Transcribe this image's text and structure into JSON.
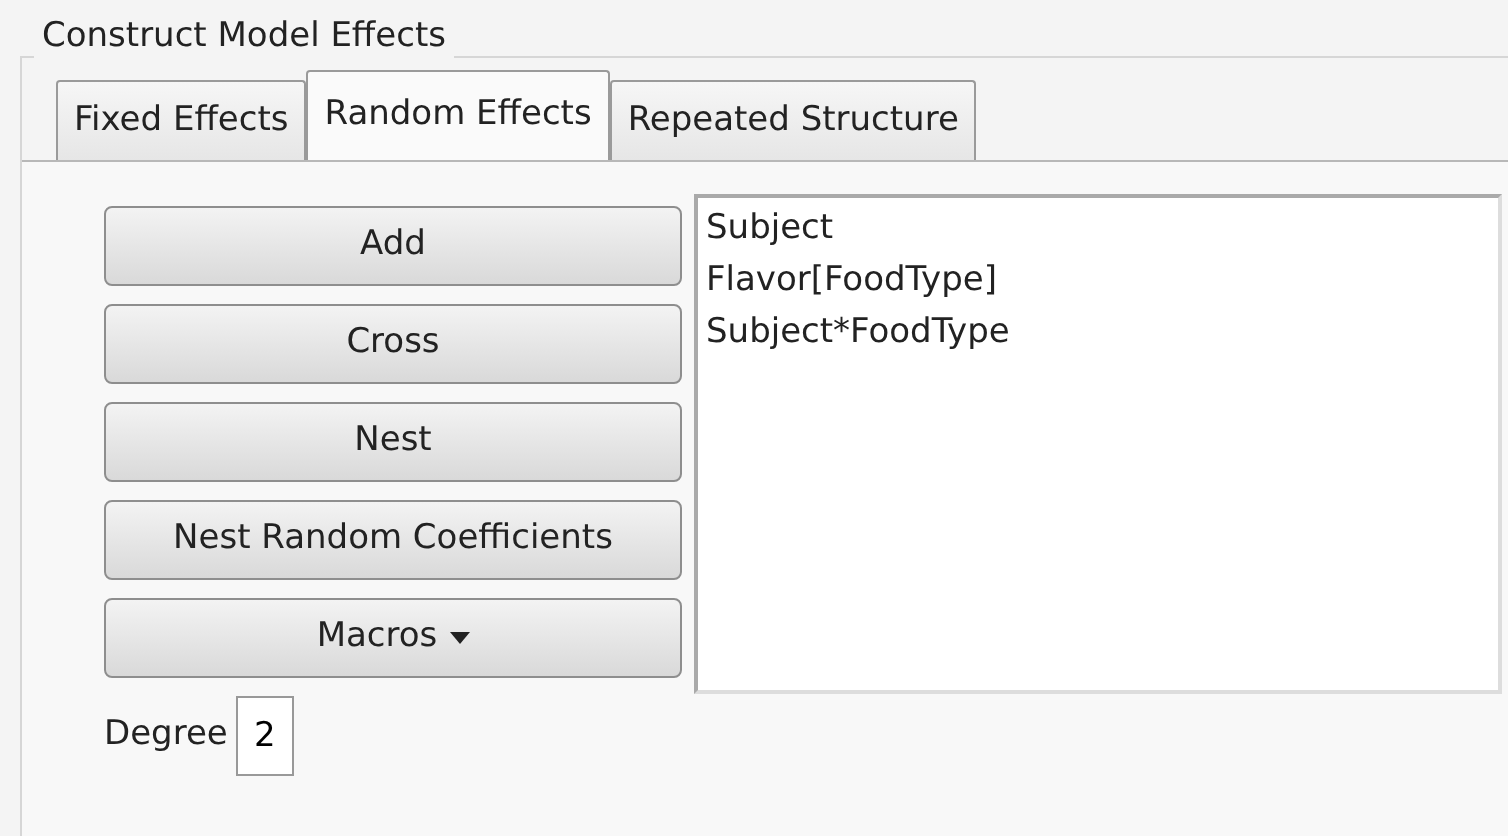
{
  "group": {
    "title": "Construct Model Effects"
  },
  "tabs": [
    {
      "label": "Fixed Effects",
      "selected": false
    },
    {
      "label": "Random Effects",
      "selected": true
    },
    {
      "label": "Repeated Structure",
      "selected": false
    }
  ],
  "buttons": [
    {
      "label": "Add",
      "kind": "plain"
    },
    {
      "label": "Cross",
      "kind": "plain"
    },
    {
      "label": "Nest",
      "kind": "plain"
    },
    {
      "label": "Nest Random Coefficients",
      "kind": "plain"
    },
    {
      "label": "Macros",
      "kind": "dropdown"
    }
  ],
  "effects": [
    "Subject",
    "Flavor[FoodType]",
    "Subject*FoodType"
  ],
  "degree": {
    "label": "Degree",
    "value": "2"
  }
}
